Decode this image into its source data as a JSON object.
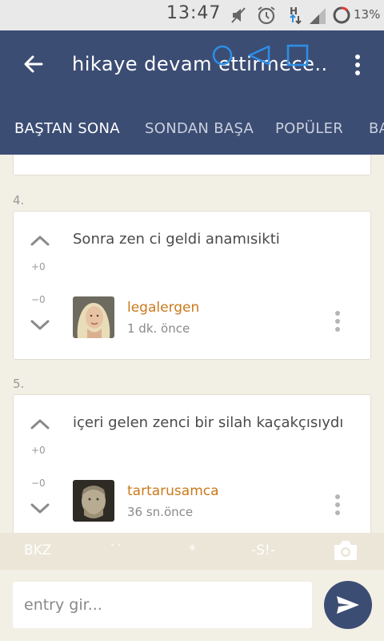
{
  "status_bar": {
    "time": "13:47",
    "battery": "13%"
  },
  "header": {
    "title": "hikaye devam ettirmece...",
    "tabs": [
      {
        "label": "BAŞTAN SONA",
        "active": true
      },
      {
        "label": "SONDAN BAŞA",
        "active": false
      },
      {
        "label": "POPÜLER",
        "active": false
      },
      {
        "label": "BA",
        "active": false
      }
    ]
  },
  "entries": [
    {
      "number": "4.",
      "text": "Sonra zen ci geldi anamısikti",
      "upvotes": "+0",
      "downvotes": "−0",
      "author": "legalergen",
      "time": "1 dk. önce",
      "avatar_icon": "woman-portrait"
    },
    {
      "number": "5.",
      "text": "içeri gelen zenci bir silah kaçakçısıydı",
      "upvotes": "+0",
      "downvotes": "−0",
      "author": "tartarusamca",
      "time": "36 sn.önce",
      "avatar_icon": "statue-portrait"
    }
  ],
  "format_bar": {
    "bkz": "BKZ",
    "backtick": "``",
    "star": "*",
    "spoiler": "-S!-"
  },
  "input": {
    "placeholder": "entry gir..."
  },
  "colors": {
    "header": "#3c4d74",
    "background": "#f2efe5",
    "author": "#c9791a"
  }
}
